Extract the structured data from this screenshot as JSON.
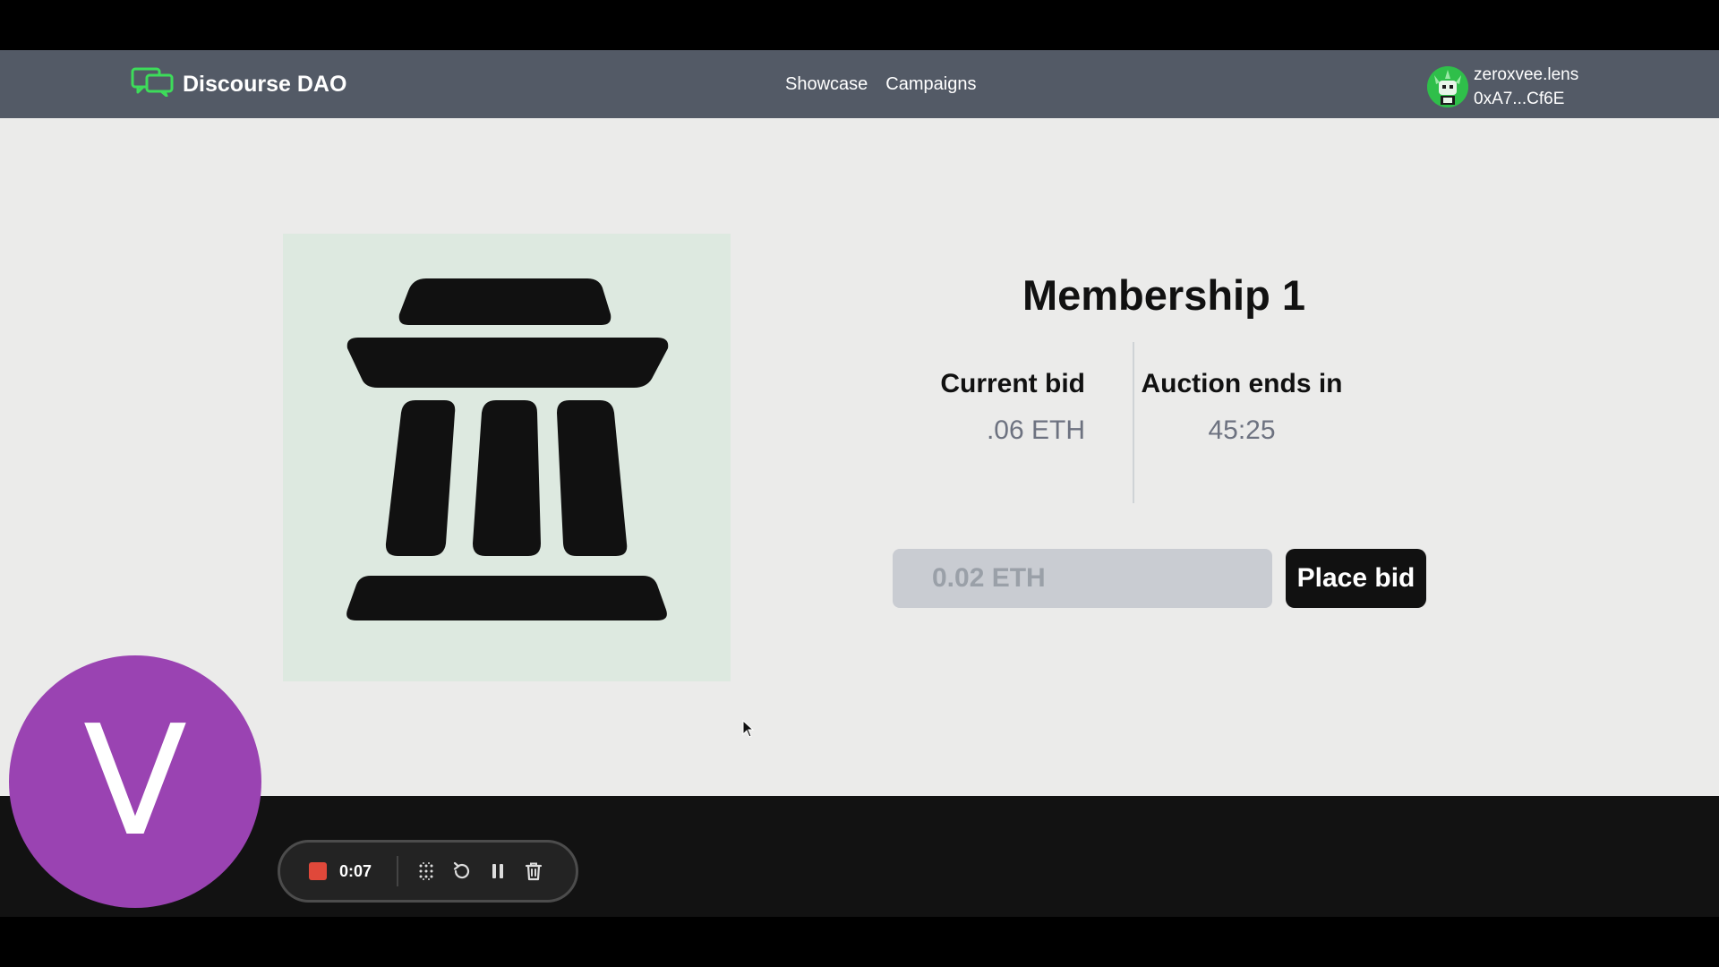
{
  "nav": {
    "brand": "Discourse DAO",
    "links": [
      "Showcase",
      "Campaigns"
    ],
    "account_name": "zeroxvee.lens",
    "account_address": "0xA7...Cf6E"
  },
  "auction": {
    "title": "Membership 1",
    "current_bid_label": "Current bid",
    "current_bid_value": ".06 ETH",
    "ends_label": "Auction ends in",
    "ends_value": "45:25",
    "bid_placeholder": "0.02 ETH",
    "bid_button": "Place bid"
  },
  "webcam": {
    "initial": "V"
  },
  "recorder": {
    "time": "0:07"
  },
  "colors": {
    "navbar": "#535a66",
    "page_bg": "#ebebea",
    "card_bg": "#dde9e0",
    "brand_icon": "#3ddc5a",
    "webcam_bg": "#9a43b2",
    "record": "#e0483a"
  },
  "icons": [
    "chat-bubbles-icon",
    "grid-dots-icon",
    "restart-icon",
    "pause-icon",
    "trash-icon",
    "cursor-icon"
  ]
}
